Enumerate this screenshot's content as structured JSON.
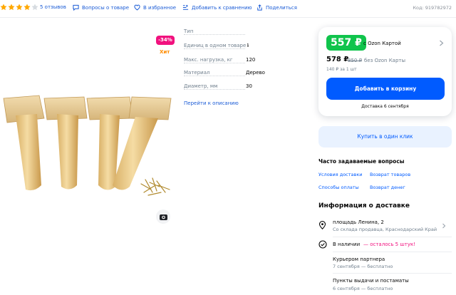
{
  "topbar": {
    "rating_stars": 4,
    "reviews": "5 отзывов",
    "questions": "Вопросы о товаре",
    "favorites": "В избранное",
    "compare": "Добавить к сравнению",
    "share": "Поделиться",
    "sku": "Код: 919782972"
  },
  "badges": {
    "discount": "-34%",
    "hit": "Хит"
  },
  "specs": [
    {
      "name": "Тип",
      "value": ""
    },
    {
      "name": "Единиц в одном товаре",
      "value": "4"
    },
    {
      "name": "Макс. нагрузка, кг",
      "value": "120"
    },
    {
      "name": "Материал",
      "value": "Дерево"
    },
    {
      "name": "Диаметр, мм",
      "value": "30"
    }
  ],
  "desc_link": "Перейти к описанию",
  "price": {
    "ozon_price": "557 ₽",
    "ozon_card_label": "с Ozon Картой",
    "regular_price": "578 ₽",
    "old_price": "850 ₽",
    "no_card_label": "без Ozon Карты",
    "per_unit": "140 ₽ за 1 шт",
    "cart_button": "Добавить в корзину",
    "delivery_date": "Доставка 6 сентября"
  },
  "one_click": "Купить в один клик",
  "faq": {
    "title": "Часто задаваемые вопросы",
    "links": [
      "Условия доставки",
      "Возврат товаров",
      "Способы оплаты",
      "Возврат денег"
    ]
  },
  "delivery": {
    "title": "Информация о доставке",
    "address": "площадь Ленина, 2",
    "warehouse": "Со склада продавца, Краснодарский Край",
    "in_stock": "В наличии",
    "in_stock_warning": "— осталось 5 штук!",
    "options": [
      {
        "title": "Курьером партнера",
        "subtitle": "7 сентября — бесплатно"
      },
      {
        "title": "Пункты выдачи и постаматы",
        "subtitle": "6 сентября — бесплатно"
      }
    ]
  },
  "colors": {
    "ozon_blue": "#005bff",
    "ozon_green": "#10c44c",
    "ozon_pink": "#f1117e",
    "star": "#ffa800"
  }
}
